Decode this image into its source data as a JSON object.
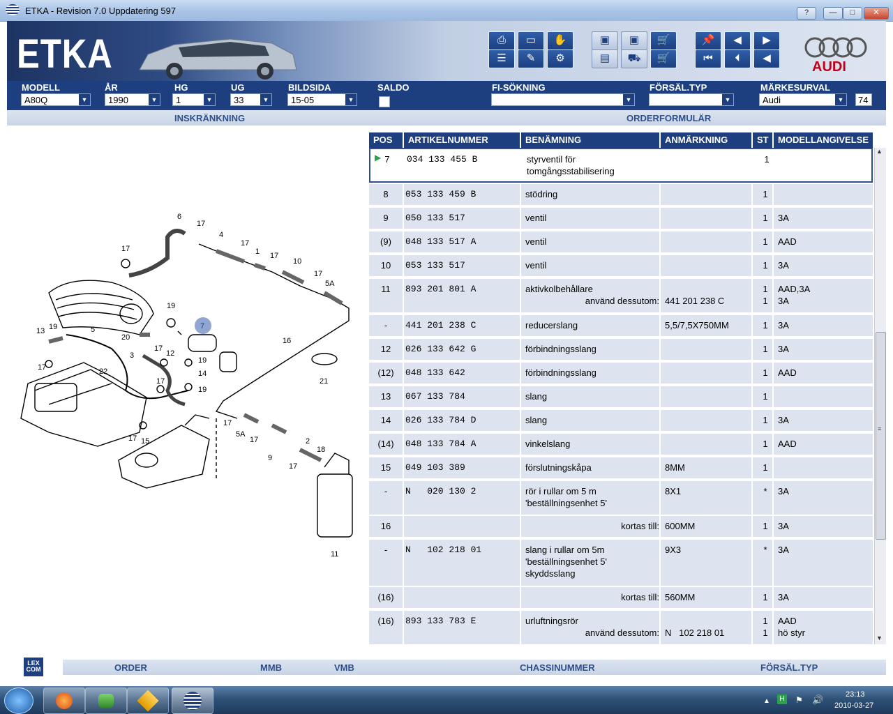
{
  "window": {
    "title": "ETKA - Revision 7.0 Uppdatering 597",
    "help": "?",
    "minimize": "—",
    "maximize": "□",
    "close": "✕"
  },
  "logo": {
    "etka": "ETKA",
    "brand": "AUDI"
  },
  "filters": {
    "modell": {
      "label": "MODELL",
      "value": "A80Q"
    },
    "ar": {
      "label": "ÅR",
      "value": "1990"
    },
    "hg": {
      "label": "HG",
      "value": "1"
    },
    "ug": {
      "label": "UG",
      "value": "33"
    },
    "bildsida": {
      "label": "BILDSIDA",
      "value": "15-05"
    },
    "saldo": {
      "label": "SALDO"
    },
    "fi": {
      "label": "FI-SÖKNING",
      "value": ""
    },
    "forsal": {
      "label": "FÖRSÄL.TYP",
      "value": ""
    },
    "marke": {
      "label": "MÄRKESURVAL",
      "value": "Audi",
      "count": "74"
    }
  },
  "subbar": {
    "inskrankning": "INSKRÄNKNING",
    "orderformular": "ORDERFORMULÄR"
  },
  "table": {
    "headers": [
      "POS",
      "ARTIKELNUMMER",
      "BENÄMNING",
      "ANMÄRKNING",
      "ST",
      "MODELLANGIVELSE"
    ],
    "rows": [
      {
        "pos": "7",
        "art": "034 133 455 B",
        "ben": "styrventil för\ntomgångsstabilisering",
        "anm": "",
        "st": "1",
        "mod": ""
      },
      {
        "pos": "8",
        "art": "053 133 459 B",
        "ben": "stödring",
        "anm": "",
        "st": "1",
        "mod": ""
      },
      {
        "pos": "9",
        "art": "050 133 517",
        "ben": "ventil",
        "anm": "",
        "st": "1",
        "mod": "3A"
      },
      {
        "pos": "(9)",
        "art": "048 133 517 A",
        "ben": "ventil",
        "anm": "",
        "st": "1",
        "mod": "AAD"
      },
      {
        "pos": "10",
        "art": "053 133 517",
        "ben": "ventil",
        "anm": "",
        "st": "1",
        "mod": "3A"
      },
      {
        "pos": "11",
        "art": "893 201 801 A",
        "ben": "aktivkolbehållare",
        "ben2": "använd dessutom:",
        "anm": "441 201 238 C",
        "st": "1",
        "st2": "1",
        "mod": "AAD,3A",
        "mod2": "3A"
      },
      {
        "pos": "-",
        "art": "441 201 238 C",
        "ben": "reducerslang",
        "anm": "5,5/7,5X750MM",
        "st": "1",
        "mod": "3A"
      },
      {
        "pos": "12",
        "art": "026 133 642 G",
        "ben": "förbindningsslang",
        "anm": "",
        "st": "1",
        "mod": "3A"
      },
      {
        "pos": "(12)",
        "art": "048 133 642",
        "ben": "förbindningsslang",
        "anm": "",
        "st": "1",
        "mod": "AAD"
      },
      {
        "pos": "13",
        "art": "067 133 784",
        "ben": "slang",
        "anm": "",
        "st": "1",
        "mod": ""
      },
      {
        "pos": "14",
        "art": "026 133 784 D",
        "ben": "slang",
        "anm": "",
        "st": "1",
        "mod": "3A"
      },
      {
        "pos": "(14)",
        "art": "048 133 784 A",
        "ben": "vinkelslang",
        "anm": "",
        "st": "1",
        "mod": "AAD"
      },
      {
        "pos": "15",
        "art": "049 103 389",
        "ben": "förslutningskåpa",
        "anm": "8MM",
        "st": "1",
        "mod": ""
      },
      {
        "pos": "-",
        "art": "N   020 130 2",
        "ben": "rör i rullar om 5 m\n'beställningsenhet 5'",
        "anm": "8X1",
        "st": "*",
        "mod": "3A"
      },
      {
        "pos": "16",
        "art": "",
        "ben2": "kortas till:",
        "anm": "600MM",
        "st": "1",
        "mod": "3A"
      },
      {
        "pos": "-",
        "art": "N   102 218 01",
        "ben": "slang i rullar om 5m\n'beställningsenhet 5'\nskyddsslang",
        "anm": "9X3",
        "st": "*",
        "mod": "3A"
      },
      {
        "pos": "(16)",
        "art": "",
        "ben2": "kortas till:",
        "anm": "560MM",
        "st": "1",
        "mod": "3A"
      },
      {
        "pos": "(16)",
        "art": "893 133 783 E",
        "ben": "urluftningsrör",
        "ben2": "använd dessutom:",
        "anm": "N   102 218 01",
        "st": "1",
        "st2": "1",
        "mod": "AAD",
        "mod2": "hö styr"
      }
    ]
  },
  "diagram": {
    "labels": [
      "6",
      "17",
      "4",
      "17",
      "1",
      "17",
      "10",
      "17",
      "5A",
      "19",
      "13",
      "5",
      "20",
      "7",
      "19",
      "3",
      "17",
      "12",
      "17",
      "14",
      "22",
      "19",
      "16",
      "17",
      "5A",
      "17",
      "9",
      "17",
      "2",
      "18",
      "21",
      "17",
      "15",
      "11"
    ]
  },
  "footer": {
    "lex": "LEX\nCOM",
    "order": "ORDER",
    "mmb": "MMB",
    "vmb": "VMB",
    "chassi": "CHASSINUMMER",
    "forsal": "FÖRSÄL.TYP"
  },
  "taskbar": {
    "time": "23:13",
    "date": "2010-03-27"
  }
}
